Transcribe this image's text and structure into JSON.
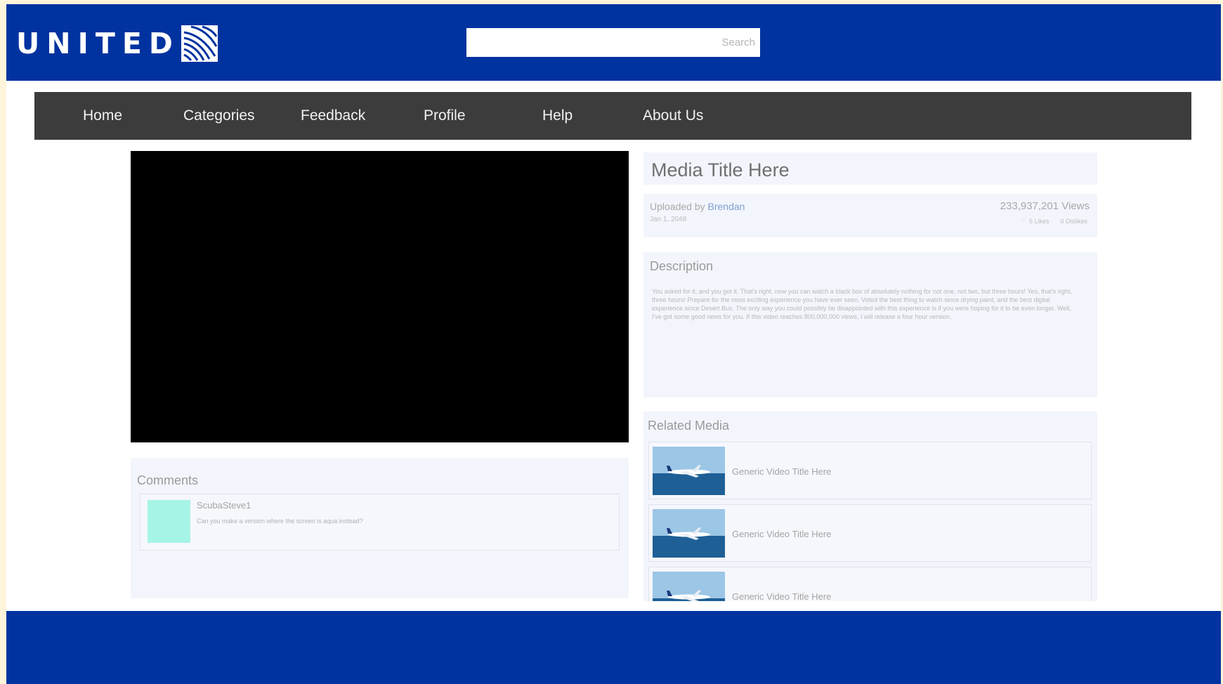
{
  "header": {
    "logo_text": "UNITED",
    "logo_icon": "united-globe-icon",
    "search_label": "Search",
    "bg_color": "#0033a0"
  },
  "nav": {
    "items": [
      {
        "label": "Home"
      },
      {
        "label": "Categories"
      },
      {
        "label": "Feedback"
      },
      {
        "label": "Profile"
      },
      {
        "label": "Help"
      },
      {
        "label": "About Us"
      }
    ]
  },
  "media": {
    "title": "Media Title Here",
    "uploaded_prefix": "Uploaded by ",
    "uploader": "Brendan",
    "date": "Jan 1, 2048",
    "views": "233,937,201 Views",
    "likes": "5 Likes",
    "dislikes": "0 Dislikes"
  },
  "description": {
    "heading": "Description",
    "text": "You asked for it, and you got it. That's right, now you can watch a black box of absolutely nothing for not one, not two, but three hours! Yes, that's right, three hours! Prepare for the most exciting experience you have ever seen. Voted the best thing to watch since drying paint, and the best digital experience since Desert Bus. The only way you could possibly be disappointed with this experience is if you were hoping for it to be even longer. Well, I've got some good news for you. If this video reaches 800,000,000 views, I will release a four hour version."
  },
  "comments": {
    "heading": "Comments",
    "items": [
      {
        "user": "ScubaSteve1",
        "text": "Can you make a version where the screen is aqua instead?"
      }
    ]
  },
  "related": {
    "heading": "Related Media",
    "items": [
      {
        "title": "Generic Video Title Here"
      },
      {
        "title": "Generic Video Title Here"
      },
      {
        "title": "Generic Video Title Here"
      }
    ]
  },
  "colors": {
    "brand_blue": "#0033a0",
    "nav_bg": "#3c3c3c",
    "panel_bg": "#f3f5fc",
    "avatar": "#a6f4e6"
  }
}
